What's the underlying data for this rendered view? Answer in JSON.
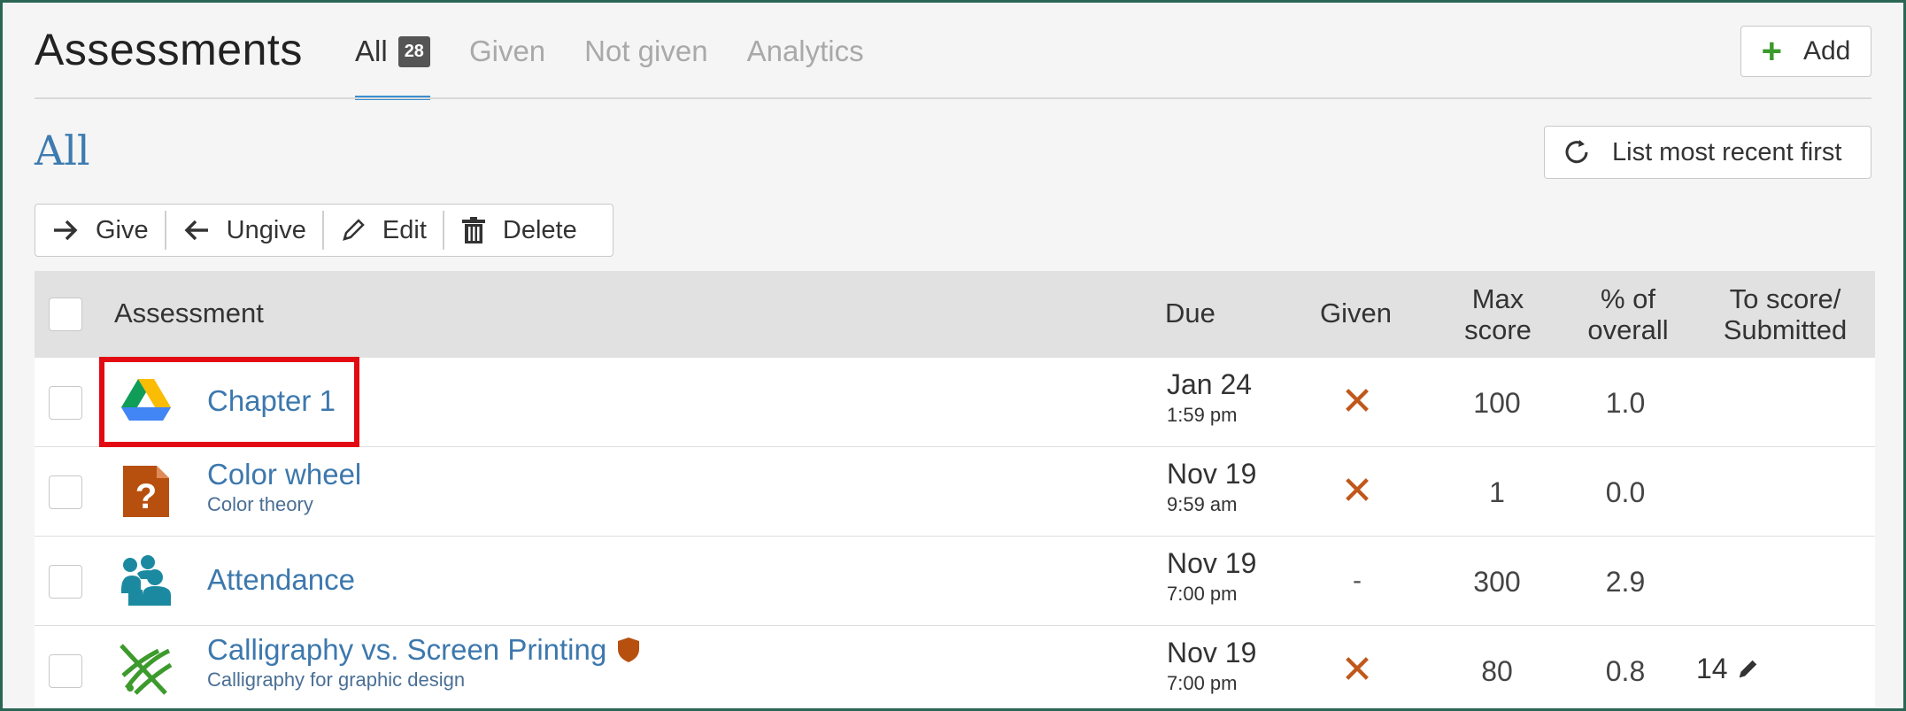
{
  "header": {
    "title": "Assessments",
    "tabs": [
      {
        "label": "All",
        "badge": "28",
        "active": true
      },
      {
        "label": "Given",
        "active": false
      },
      {
        "label": "Not given",
        "active": false
      },
      {
        "label": "Analytics",
        "active": false
      }
    ],
    "add_label": "Add"
  },
  "section": {
    "title": "All",
    "sort_label": "List most recent first"
  },
  "toolbar": {
    "give": "Give",
    "ungive": "Ungive",
    "edit": "Edit",
    "delete": "Delete"
  },
  "table": {
    "headers": {
      "assessment": "Assessment",
      "due": "Due",
      "given": "Given",
      "max_score_1": "Max",
      "max_score_2": "score",
      "pct_1": "% of",
      "pct_2": "overall",
      "to_score_1": "To score/",
      "to_score_2": "Submitted"
    },
    "rows": [
      {
        "icon": "google-drive-icon",
        "name": "Chapter 1",
        "subtitle": "",
        "due_date": "Jan 24",
        "due_time": "1:59 pm",
        "given": "✕",
        "max_score": "100",
        "pct": "1.0",
        "to_score": ""
      },
      {
        "icon": "question-file-icon",
        "name": "Color wheel",
        "subtitle": "Color theory",
        "due_date": "Nov 19",
        "due_time": "9:59 am",
        "given": "✕",
        "max_score": "1",
        "pct": "0.0",
        "to_score": ""
      },
      {
        "icon": "attendance-icon",
        "name": "Attendance",
        "subtitle": "",
        "due_date": "Nov 19",
        "due_time": "7:00 pm",
        "given": "-",
        "max_score": "300",
        "pct": "2.9",
        "to_score": ""
      },
      {
        "icon": "discussion-icon",
        "name": "Calligraphy vs. Screen Printing",
        "subtitle": "Calligraphy for graphic design",
        "due_date": "Nov 19",
        "due_time": "7:00 pm",
        "given": "✕",
        "max_score": "80",
        "pct": "0.8",
        "to_score": "14"
      }
    ]
  },
  "colors": {
    "accent": "#3a8fd0",
    "link": "#3d78ad",
    "given_x": "#c0571b",
    "highlight": "#e30b13",
    "frame": "#2b6654"
  }
}
